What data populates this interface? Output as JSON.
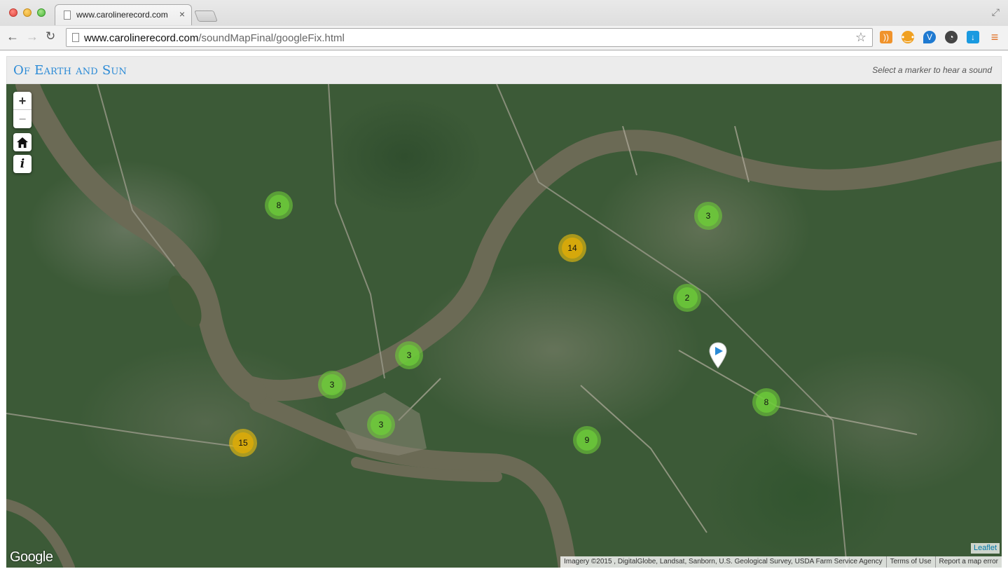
{
  "browser": {
    "tab_title": "www.carolinerecord.com",
    "tab_close": "×",
    "url_host": "www.carolinerecord.com",
    "url_path": "/soundMapFinal/googleFix.html",
    "nav": {
      "back": "←",
      "forward": "→",
      "reload": "↻"
    },
    "star": "☆"
  },
  "page": {
    "title": "Of Earth and Sun",
    "instruction": "Select a marker to hear a sound"
  },
  "map": {
    "zoom_in": "+",
    "zoom_out": "−",
    "info": "i",
    "clusters": [
      {
        "label": "8",
        "size": "small"
      },
      {
        "label": "14",
        "size": "medium"
      },
      {
        "label": "3",
        "size": "small"
      },
      {
        "label": "2",
        "size": "small"
      },
      {
        "label": "3",
        "size": "small"
      },
      {
        "label": "3",
        "size": "small"
      },
      {
        "label": "3",
        "size": "small"
      },
      {
        "label": "15",
        "size": "medium"
      },
      {
        "label": "9",
        "size": "small"
      },
      {
        "label": "8",
        "size": "small"
      }
    ],
    "cluster_colors": {
      "small": "#6ecc39",
      "medium": "#f0c20c"
    },
    "google_logo": "Google",
    "leaflet_link": "Leaflet",
    "imagery_credit": "Imagery ©2015 , DigitalGlobe, Landsat, Sanborn, U.S. Geological Survey, USDA Farm Service Agency",
    "terms": "Terms of Use",
    "report": "Report a map error"
  }
}
